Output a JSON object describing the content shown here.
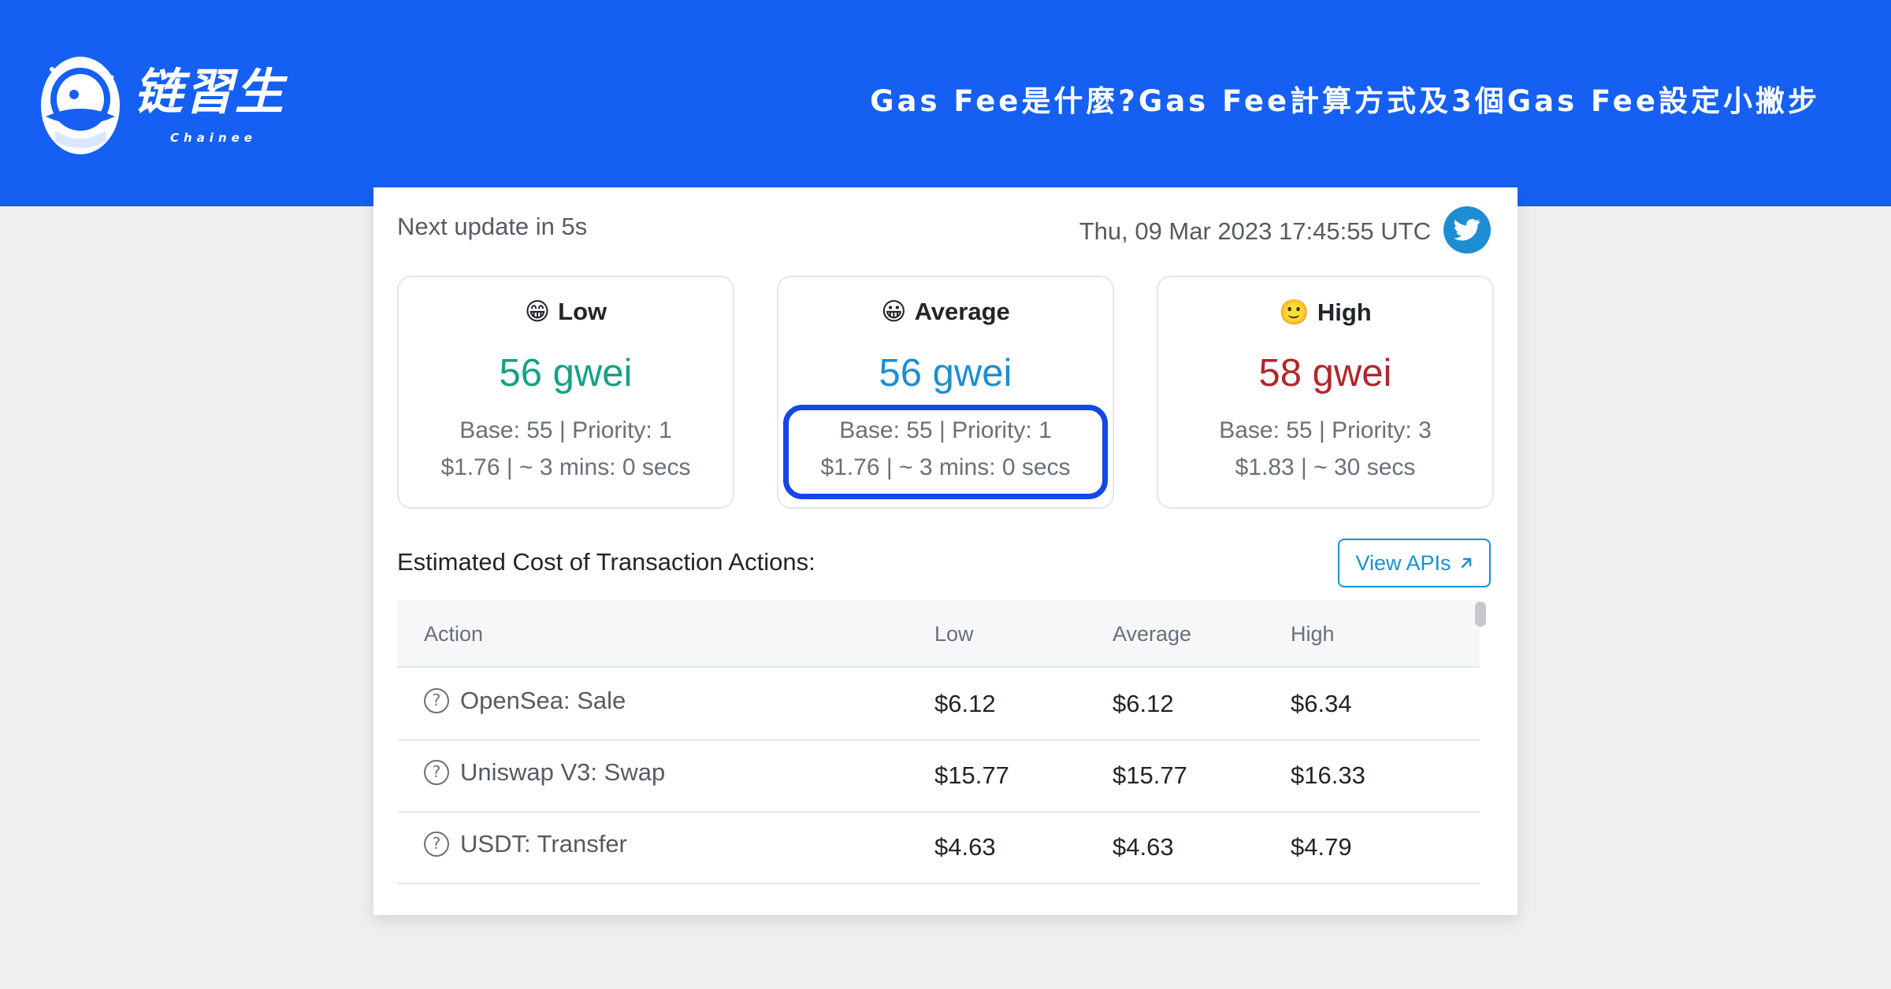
{
  "brand": {
    "name": "链習生",
    "sub": "Chainee"
  },
  "headline": "Gas Fee是什麼?Gas Fee計算方式及3個Gas Fee設定小撇步",
  "tracker": {
    "next_update": "Next update in 5s",
    "timestamp": "Thu, 09 Mar 2023 17:45:55 UTC",
    "tiers": [
      {
        "emoji": "😁",
        "label": "Low",
        "price": "56 gwei",
        "line1": "Base: 55 | Priority: 1",
        "line2": "$1.76 | ~ 3 mins: 0 secs",
        "color": "#16a085"
      },
      {
        "emoji": "😀",
        "label": "Average",
        "price": "56 gwei",
        "line1": "Base: 55 | Priority: 1",
        "line2": "$1.76 | ~ 3 mins: 0 secs",
        "color": "#1d8ed3"
      },
      {
        "emoji": "🙂",
        "label": "High",
        "price": "58 gwei",
        "line1": "Base: 55 | Priority: 3",
        "line2": "$1.83 | ~ 30 secs",
        "color": "#b3262c"
      }
    ],
    "section_title": "Estimated Cost of Transaction Actions:",
    "view_apis": "View APIs",
    "table": {
      "headers": [
        "Action",
        "Low",
        "Average",
        "High"
      ],
      "rows": [
        {
          "action": "OpenSea: Sale",
          "low": "$6.12",
          "average": "$6.12",
          "high": "$6.34"
        },
        {
          "action": "Uniswap V3: Swap",
          "low": "$15.77",
          "average": "$15.77",
          "high": "$16.33"
        },
        {
          "action": "USDT: Transfer",
          "low": "$4.63",
          "average": "$4.63",
          "high": "$4.79"
        }
      ]
    }
  },
  "colors": {
    "banner": "#1560f2",
    "highlight": "#1347e8",
    "link": "#1d8ed3"
  }
}
